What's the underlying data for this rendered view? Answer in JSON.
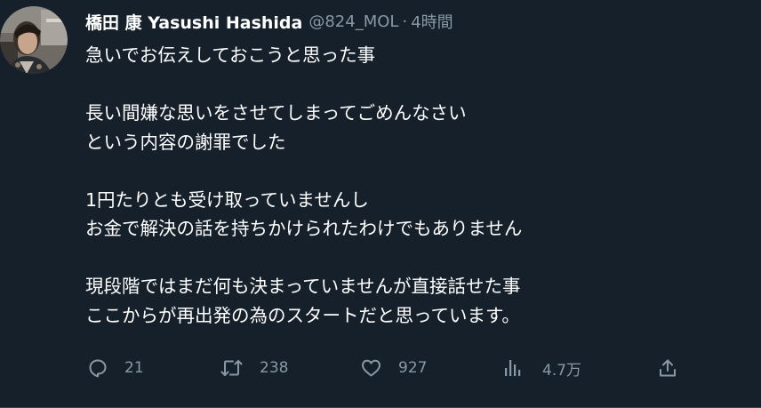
{
  "author": {
    "display_name": "橋田 康 Yasushi Hashida",
    "handle": "@824_MOL",
    "separator": "·",
    "time": "4時間"
  },
  "tweet": {
    "lines": [
      "急いでお伝えしておこうと思った事",
      "",
      "長い間嫌な思いをさせてしまってごめんなさい",
      "という内容の謝罪でした",
      "",
      "1円たりとも受け取っていませんし",
      "お金で解決の話を持ちかけられたわけでもありません",
      "",
      "現段階ではまだ何も決まっていませんが直接話せた事",
      "ここからが再出発の為のスタートだと思っています。"
    ]
  },
  "actions": {
    "reply": {
      "icon": "reply-icon",
      "count": "21"
    },
    "retweet": {
      "icon": "retweet-icon",
      "count": "238"
    },
    "like": {
      "icon": "heart-icon",
      "count": "927"
    },
    "views": {
      "icon": "views-icon",
      "count": "4.7万"
    },
    "share": {
      "icon": "share-icon"
    }
  },
  "colors": {
    "background": "#15202b",
    "text": "#ffffff",
    "secondary": "#8899a6",
    "divider": "#38444d"
  }
}
